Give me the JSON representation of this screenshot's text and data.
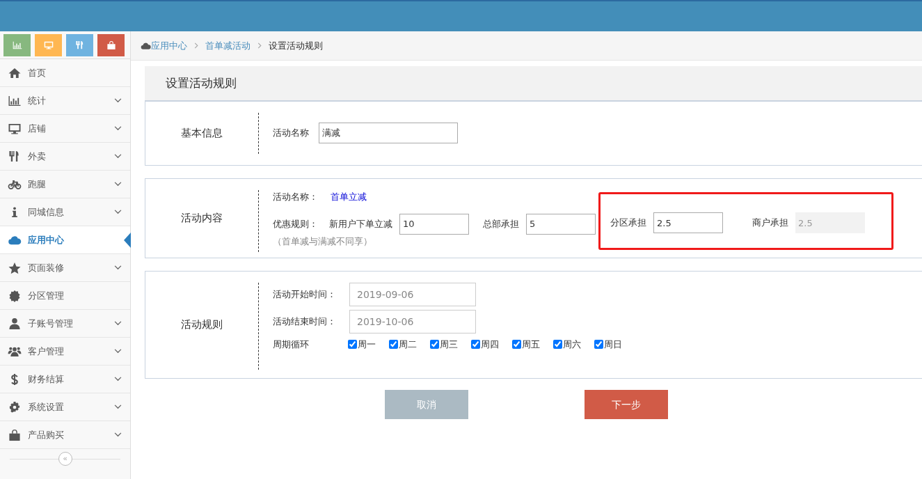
{
  "quick_tiles": [
    {
      "kind": "chart",
      "color": "#87b87f"
    },
    {
      "kind": "monitor",
      "color": "#ffb752"
    },
    {
      "kind": "cutlery",
      "color": "#6fb3e0"
    },
    {
      "kind": "bag",
      "color": "#d15b47"
    }
  ],
  "sidebar": {
    "items": [
      {
        "label": "首页",
        "expandable": false,
        "selected": false
      },
      {
        "label": "统计",
        "expandable": true,
        "selected": false
      },
      {
        "label": "店铺",
        "expandable": true,
        "selected": false
      },
      {
        "label": "外卖",
        "expandable": true,
        "selected": false
      },
      {
        "label": "跑腿",
        "expandable": true,
        "selected": false
      },
      {
        "label": "同城信息",
        "expandable": true,
        "selected": false
      },
      {
        "label": "应用中心",
        "expandable": false,
        "selected": true
      },
      {
        "label": "页面装修",
        "expandable": true,
        "selected": false
      },
      {
        "label": "分区管理",
        "expandable": false,
        "selected": false
      },
      {
        "label": "子账号管理",
        "expandable": true,
        "selected": false
      },
      {
        "label": "客户管理",
        "expandable": true,
        "selected": false
      },
      {
        "label": "财务结算",
        "expandable": true,
        "selected": false
      },
      {
        "label": "系统设置",
        "expandable": true,
        "selected": false
      },
      {
        "label": "产品购买",
        "expandable": true,
        "selected": false
      }
    ],
    "collapse_button": "«"
  },
  "breadcrumb": [
    {
      "label": "应用中心",
      "link": true
    },
    {
      "label": "首单减活动",
      "link": true
    },
    {
      "label": "设置活动规则",
      "link": false
    }
  ],
  "panel": {
    "title": "设置活动规则",
    "basic_info": {
      "heading": "基本信息",
      "name_label": "活动名称",
      "name_value": "满减"
    },
    "content": {
      "heading": "活动内容",
      "name_label": "活动名称：",
      "name_value": "首单立减",
      "rule_label": "优惠规则：",
      "fields": [
        {
          "label": "新用户下单立减",
          "value": "10",
          "readonly": false,
          "highlighted": false
        },
        {
          "label": "总部承担",
          "value": "5",
          "readonly": false,
          "highlighted": false
        },
        {
          "label": "分区承担",
          "value": "2.5",
          "readonly": false,
          "highlighted": true
        },
        {
          "label": "商户承担",
          "value": "2.5",
          "readonly": true,
          "highlighted": true
        }
      ],
      "note": "（首单减与满减不同享）"
    },
    "rules": {
      "heading": "活动规则",
      "start_label": "活动开始时间：",
      "start_value": "2019-09-06",
      "end_label": "活动结束时间：",
      "end_value": "2019-10-06",
      "cycle_label": "周期循环",
      "days": [
        {
          "label": "周一",
          "checked": true
        },
        {
          "label": "周二",
          "checked": true
        },
        {
          "label": "周三",
          "checked": true
        },
        {
          "label": "周四",
          "checked": true
        },
        {
          "label": "周五",
          "checked": true
        },
        {
          "label": "周六",
          "checked": true
        },
        {
          "label": "周日",
          "checked": true
        }
      ]
    }
  },
  "buttons": [
    {
      "label": "取消",
      "kind": "cancel"
    },
    {
      "label": "下一步",
      "kind": "next"
    }
  ]
}
